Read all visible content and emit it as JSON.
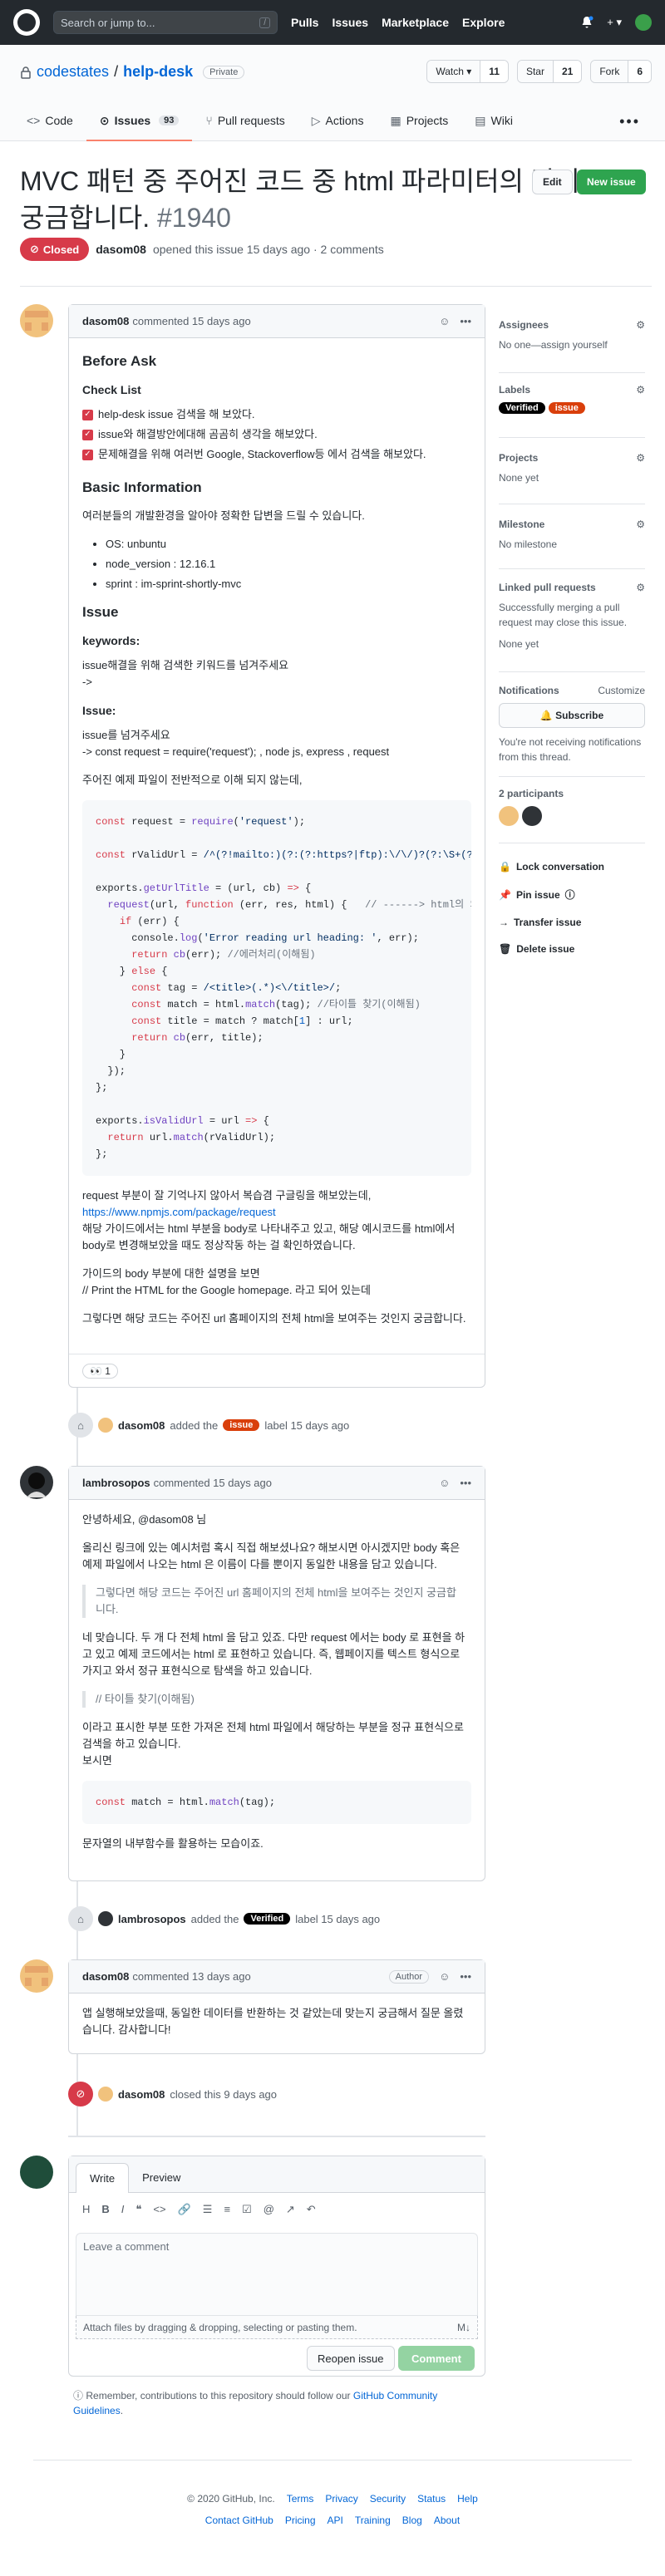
{
  "topbar": {
    "search_placeholder": "Search or jump to...",
    "search_key": "/",
    "nav": [
      "Pulls",
      "Issues",
      "Marketplace",
      "Explore"
    ],
    "plus": "+ ▾"
  },
  "repo": {
    "owner": "codestates",
    "separator": "/",
    "name": "help-desk",
    "visibility": "Private",
    "watch_label": "Watch ▾",
    "watch_count": "11",
    "star_label": "Star",
    "star_count": "21",
    "fork_label": "Fork",
    "fork_count": "6",
    "tabs": [
      {
        "label": "Code",
        "icon": "code-icon"
      },
      {
        "label": "Issues",
        "icon": "issue-icon",
        "count": "93"
      },
      {
        "label": "Pull requests",
        "icon": "pr-icon"
      },
      {
        "label": "Actions",
        "icon": "play-icon"
      },
      {
        "label": "Projects",
        "icon": "project-icon"
      },
      {
        "label": "Wiki",
        "icon": "book-icon"
      }
    ]
  },
  "issue": {
    "title": "MVC 패턴 중 주어진 코드 중 html 파라미터의 값이 궁금합니다.",
    "number": "#1940",
    "edit_label": "Edit",
    "new_label": "New issue",
    "status": "Closed",
    "author": "dasom08",
    "opened_text": "opened this issue 15 days ago · 2 comments"
  },
  "comment1": {
    "author": "dasom08",
    "meta": "commented 15 days ago",
    "h_before": "Before Ask",
    "h_check": "Check List",
    "checks": [
      "help-desk issue 검색을 해 보았다.",
      "issue와 해결방안에대해 곰곰히 생각을 해보았다.",
      "문제해결을 위해 여러번 Google, Stackoverflow등 에서 검색을 해보았다."
    ],
    "h_basic": "Basic Information",
    "basic_intro": "여러분들의 개발환경을 알아야 정확한 답변을 드릴 수 있습니다.",
    "env": [
      "OS: unbuntu",
      "node_version : 12.16.1",
      "sprint : im-sprint-shortly-mvc"
    ],
    "h_issue": "Issue",
    "h_keywords": "keywords:",
    "keywords_text": "issue해결을 위해 검색한 키워드를 넘겨주세요",
    "keywords_arrow": "->",
    "h_issue2": "Issue:",
    "issue_text1": "issue를 넘겨주세요",
    "issue_text2": "-> const request = require('request'); , node js, express , request",
    "code_intro": "주어진 예제 파일이 전반적으로 이해 되지 않는데,",
    "after1": "request 부분이 잘 기억나지 않아서 복습겸 구글링을 해보았는데,",
    "after_link": "https://www.npmjs.com/package/request",
    "after2": "해당 가이드에서는 html 부분을 body로 나타내주고 있고, 해당 예시코드를 html에서 body로 변경해보았을 때도 정상작동 하는 걸 확인하였습니다.",
    "after3": "가이드의 body 부분에 대한 설명을 보면",
    "after4": "// Print the HTML for the Google homepage. 라고 되어 있는데",
    "after5": "그렇다면 해당 코드는 주어진 url 홈페이지의 전체 html을 보여주는 것인지 궁금합니다.",
    "reaction": "👀 1"
  },
  "event1": {
    "actor": "dasom08",
    "text_before": "added the",
    "label": "issue",
    "text_after": "label 15 days ago"
  },
  "comment2": {
    "author": "lambrosopos",
    "meta": "commented 15 days ago",
    "greet": "안녕하세요, @dasom08 님",
    "p1": "올리신 링크에 있는 예시처럼 혹시 직접 해보셨나요? 해보시면 아시겠지만 body 혹은 예제 파일에서 나오는 html 은 이름이 다를 뿐이지 동일한 내용을 담고 있습니다.",
    "quote1": "그렇다면 해당 코드는 주어진 url 홈페이지의 전체 html을 보여주는 것인지 궁금합니다.",
    "p2": "네 맞습니다. 두 개 다 전체 html 을 담고 있죠. 다만 request 에서는 body 로 표현을 하고 있고 예제 코드에서는 html 로 표현하고 있습니다. 즉, 웹페이지를 텍스트 형식으로 가지고 와서 정규 표현식으로 탐색을 하고 있습니다.",
    "quote2": "// 타이틀 찾기(이해됨)",
    "p3": "이라고 표시한 부분 또한 가져온 전체 html 파일에서 해당하는 부분을 정규 표현식으로 검색을 하고 있습니다.",
    "p3b": "보시면",
    "p4": "문자열의 내부함수를 활용하는 모습이죠."
  },
  "event2": {
    "actor": "lambrosopos",
    "text_before": "added the",
    "label": "Verified",
    "text_after": "label 15 days ago"
  },
  "comment3": {
    "author": "dasom08",
    "meta": "commented 13 days ago",
    "badge": "Author",
    "body": "앱 실행해보았을때, 동일한 데이터를 반환하는 것 같았는데 맞는지 궁금해서 질문 올렸습니다. 감사합니다!"
  },
  "event3": {
    "actor": "dasom08",
    "text": "closed this 9 days ago"
  },
  "sidebar": {
    "assignees_h": "Assignees",
    "assignees_v": "No one—assign yourself",
    "labels_h": "Labels",
    "labels": [
      "Verified",
      "issue"
    ],
    "projects_h": "Projects",
    "projects_v": "None yet",
    "milestone_h": "Milestone",
    "milestone_v": "No milestone",
    "linked_h": "Linked pull requests",
    "linked_v": "Successfully merging a pull request may close this issue.",
    "linked_v2": "None yet",
    "notif_h": "Notifications",
    "notif_customize": "Customize",
    "subscribe": "🔔 Subscribe",
    "notif_v": "You're not receiving notifications from this thread.",
    "participants_h": "2 participants",
    "lock": "Lock conversation",
    "pin": "Pin issue",
    "transfer": "Transfer issue",
    "delete": "Delete issue"
  },
  "composer": {
    "tab_write": "Write",
    "tab_preview": "Preview",
    "placeholder": "Leave a comment",
    "attach": "Attach files by dragging & dropping, selecting or pasting them.",
    "attach_icon": "M↓",
    "reopen": "Reopen issue",
    "comment": "Comment",
    "note": "Remember, contributions to this repository should follow our",
    "note_link": "GitHub Community Guidelines",
    "note_end": "."
  },
  "footer": {
    "row1": [
      "© 2020 GitHub, Inc.",
      "Terms",
      "Privacy",
      "Security",
      "Status",
      "Help"
    ],
    "row2": [
      "Contact GitHub",
      "Pricing",
      "API",
      "Training",
      "Blog",
      "About"
    ]
  }
}
